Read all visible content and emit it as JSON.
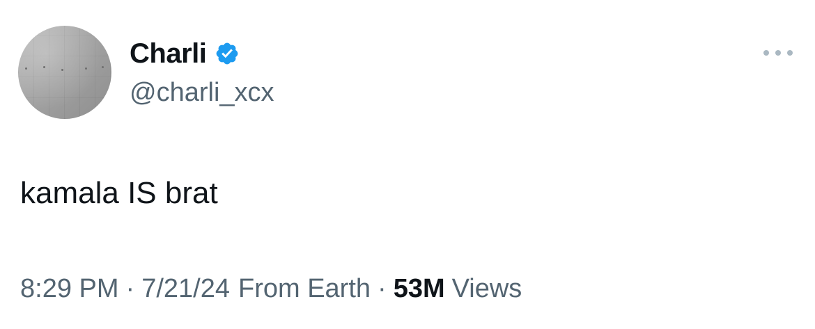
{
  "author": {
    "display_name": "Charli",
    "handle": "@charli_xcx",
    "verified_icon": "verified-badge-icon",
    "avatar_icon": "avatar"
  },
  "tweet": {
    "text": "kamala IS brat"
  },
  "meta": {
    "time": "8:29 PM",
    "separator": "·",
    "date": "7/21/24",
    "source": "From Earth",
    "views_count": "53M",
    "views_label": "Views"
  },
  "colors": {
    "text_primary": "#0f1419",
    "text_secondary": "#536471",
    "verified_blue": "#1d9bf0",
    "more_dots": "#aab8c2"
  },
  "icons": {
    "more": "more-options-icon"
  }
}
